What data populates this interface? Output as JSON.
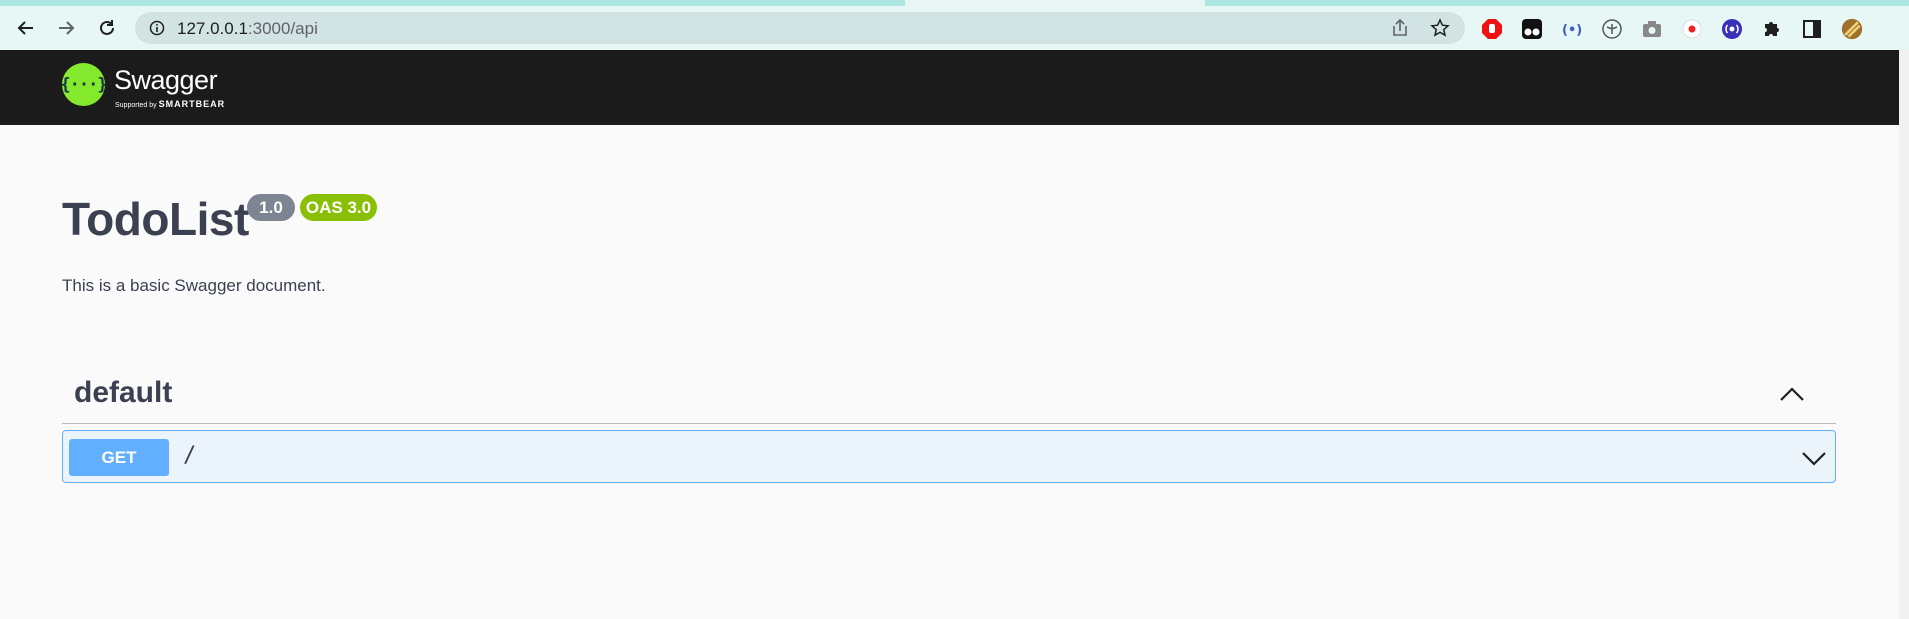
{
  "browser": {
    "url_host": "127.0.0.1",
    "url_path": ":3000/api"
  },
  "swagger": {
    "logo_mark": "{···}",
    "brand": "Swagger",
    "supported_by": "Supported by",
    "smartbear": "SMARTBEAR"
  },
  "info": {
    "title": "TodoList",
    "version": "1.0",
    "oas": "OAS 3.0",
    "description": "This is a basic Swagger document."
  },
  "tag": {
    "name": "default",
    "operations": [
      {
        "method": "GET",
        "path": "/"
      }
    ]
  },
  "colors": {
    "topbar": "#1b1b1b",
    "logo_green": "#85ea2d",
    "get_blue": "#61affe",
    "version_badge": "#7d8492",
    "oas_badge": "#89bf04"
  }
}
